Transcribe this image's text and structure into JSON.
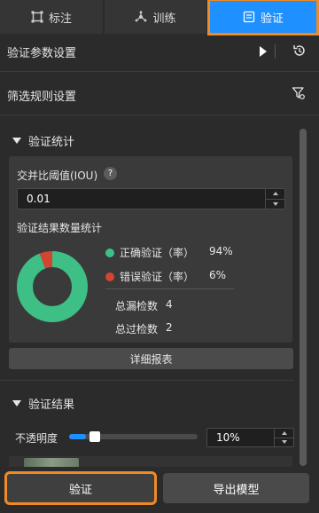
{
  "tabs": [
    {
      "label": "标注",
      "icon": "annotate-icon",
      "active": false
    },
    {
      "label": "训练",
      "icon": "train-icon",
      "active": false
    },
    {
      "label": "验证",
      "icon": "validate-icon",
      "active": true
    }
  ],
  "params_section": {
    "title": "验证参数设置"
  },
  "filter_section": {
    "title": "筛选规则设置"
  },
  "stats_section": {
    "title": "验证统计",
    "iou_label": "交并比阈值(IOU)",
    "iou_value": "0.01",
    "result_count_label": "验证结果数量统计",
    "legend": [
      {
        "label": "正确验证（率）",
        "value": "94%",
        "color": "#3dbf86"
      },
      {
        "label": "错误验证（率）",
        "value": "6%",
        "color": "#d2462f"
      }
    ],
    "missed_label": "总漏检数",
    "missed_value": "4",
    "over_label": "总过检数",
    "over_value": "2",
    "detail_button": "详细报表"
  },
  "chart_data": {
    "type": "pie",
    "categories": [
      "正确验证（率）",
      "错误验证（率）"
    ],
    "values": [
      94,
      6
    ],
    "colors": [
      "#3dbf86",
      "#d2462f"
    ]
  },
  "results_section": {
    "title": "验证结果",
    "opacity_label": "不透明度",
    "opacity_value": "10%",
    "opacity_fraction": 0.1
  },
  "buttons": {
    "verify": "验证",
    "export": "导出模型"
  },
  "colors": {
    "accent": "#1e90ff",
    "highlight": "#f08a24"
  }
}
